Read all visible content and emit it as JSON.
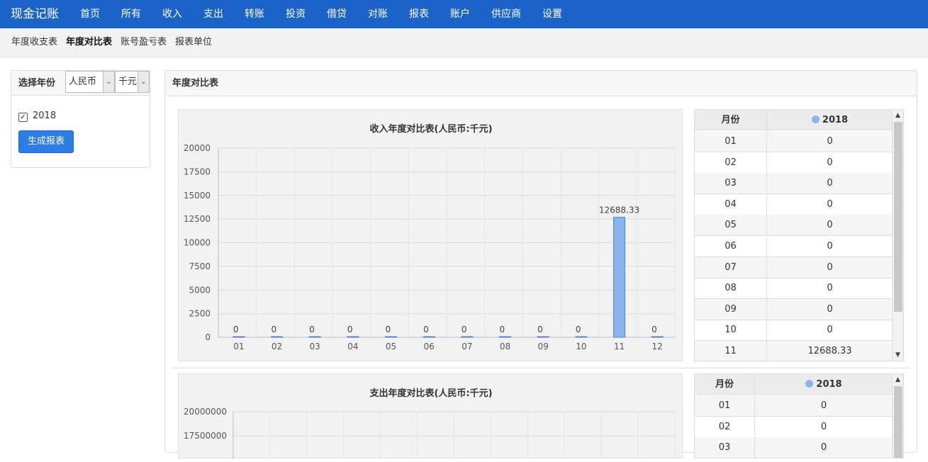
{
  "brand": "现金记账",
  "nav": [
    "首页",
    "所有",
    "收入",
    "支出",
    "转账",
    "投资",
    "借贷",
    "对账",
    "报表",
    "账户",
    "供应商",
    "设置"
  ],
  "subnav": [
    "年度收支表",
    "年度对比表",
    "账号盈亏表",
    "报表单位"
  ],
  "left": {
    "title": "选择年份",
    "currency": "人民币",
    "unit": "千元",
    "year": "2018",
    "button": "生成报表"
  },
  "main": {
    "title": "年度对比表"
  },
  "income_chart": {
    "title": "收入年度对比表(人民币:千元)",
    "y_ticks": [
      "20000",
      "17500",
      "15000",
      "12500",
      "10000",
      "7500",
      "5000",
      "2500",
      "0"
    ],
    "categories": [
      "01",
      "02",
      "03",
      "04",
      "05",
      "06",
      "07",
      "08",
      "09",
      "10",
      "11",
      "12"
    ],
    "labels": [
      "0",
      "0",
      "0",
      "0",
      "0",
      "0",
      "0",
      "0",
      "0",
      "0",
      "12688.33",
      "0"
    ]
  },
  "expense_chart": {
    "title": "支出年度对比表(人民币:千元)",
    "y_ticks": [
      "20000000",
      "17500000"
    ]
  },
  "table1": {
    "col_month": "月份",
    "col_series": "2018",
    "rows": [
      {
        "m": "01",
        "v": "0"
      },
      {
        "m": "02",
        "v": "0"
      },
      {
        "m": "03",
        "v": "0"
      },
      {
        "m": "04",
        "v": "0"
      },
      {
        "m": "05",
        "v": "0"
      },
      {
        "m": "06",
        "v": "0"
      },
      {
        "m": "07",
        "v": "0"
      },
      {
        "m": "08",
        "v": "0"
      },
      {
        "m": "09",
        "v": "0"
      },
      {
        "m": "10",
        "v": "0"
      },
      {
        "m": "11",
        "v": "12688.33"
      }
    ]
  },
  "table2": {
    "col_month": "月份",
    "col_series": "2018",
    "rows": [
      {
        "m": "01",
        "v": "0"
      },
      {
        "m": "02",
        "v": "0"
      },
      {
        "m": "03",
        "v": "0"
      }
    ]
  },
  "chart_data": [
    {
      "type": "bar",
      "title": "收入年度对比表(人民币:千元)",
      "categories": [
        "01",
        "02",
        "03",
        "04",
        "05",
        "06",
        "07",
        "08",
        "09",
        "10",
        "11",
        "12"
      ],
      "series": [
        {
          "name": "2018",
          "values": [
            0,
            0,
            0,
            0,
            0,
            0,
            0,
            0,
            0,
            0,
            12688.33,
            0
          ]
        }
      ],
      "ylim": [
        0,
        20000
      ],
      "grid": true,
      "colors": {
        "bar": "#8ab4f0",
        "bar_edge": "#4a86e0"
      }
    },
    {
      "type": "bar",
      "title": "支出年度对比表(人民币:千元)",
      "ylim": [
        0,
        20000000
      ],
      "grid": true
    }
  ]
}
